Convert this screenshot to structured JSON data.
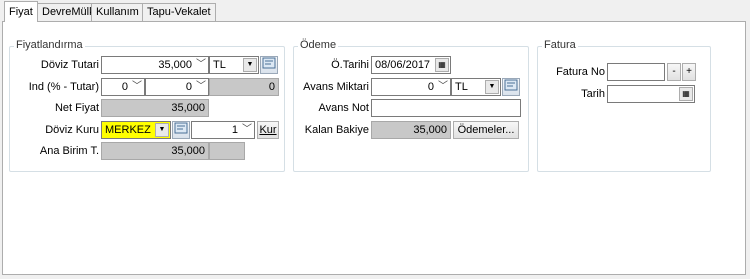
{
  "tabs": [
    {
      "label": "Fiyat",
      "active": true
    },
    {
      "label": "DevreMülk",
      "active": false
    },
    {
      "label": "Kullanım",
      "active": false
    },
    {
      "label": "Tapu-Vekalet",
      "active": false
    }
  ],
  "fiyat_group": {
    "title": "Fiyatlandırma",
    "doviz_tutari": {
      "label": "Döviz Tutari",
      "value": "35,000",
      "currency": "TL"
    },
    "ind": {
      "label": "Ind (% - Tutar)",
      "percent": "0",
      "amount": "0",
      "result": "0"
    },
    "net_fiyat": {
      "label": "Net Fiyat",
      "value": "35,000"
    },
    "doviz_kuru": {
      "label": "Döviz Kuru",
      "source": "MERKEZ",
      "rate": "1",
      "kur_button": "Kur"
    },
    "ana_birim": {
      "label": "Ana Birim T.",
      "value": "35,000"
    }
  },
  "odeme_group": {
    "title": "Ödeme",
    "tarih": {
      "label": "Ö.Tarihi",
      "value": "08/06/2017"
    },
    "avans_miktari": {
      "label": "Avans Miktari",
      "value": "0",
      "currency": "TL"
    },
    "avans_not": {
      "label": "Avans Not",
      "value": ""
    },
    "kalan_bakiye": {
      "label": "Kalan Bakiye",
      "value": "35,000",
      "button": "Ödemeler..."
    }
  },
  "fatura_group": {
    "title": "Fatura",
    "fatura_no": {
      "label": "Fatura No",
      "value": "",
      "minus": "-",
      "plus": "+"
    },
    "tarih": {
      "label": "Tarih",
      "value": ""
    }
  },
  "colors": {
    "highlight": "#ffff00",
    "readonly": "#c8c8c8",
    "panel": "#ffffff"
  }
}
